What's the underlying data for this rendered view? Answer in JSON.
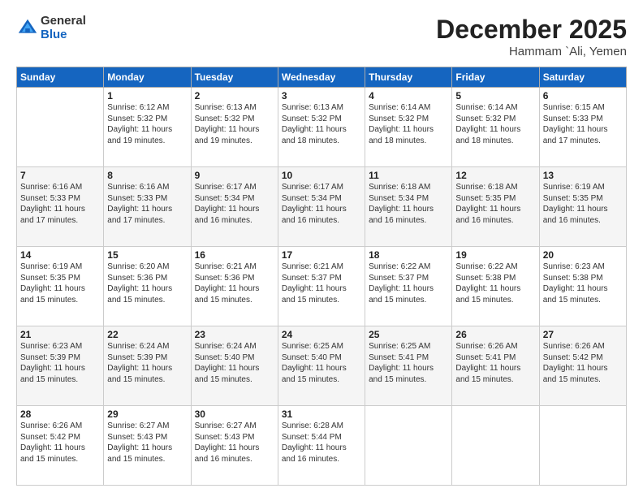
{
  "header": {
    "logo_general": "General",
    "logo_blue": "Blue",
    "month": "December 2025",
    "location": "Hammam `Ali, Yemen"
  },
  "weekdays": [
    "Sunday",
    "Monday",
    "Tuesday",
    "Wednesday",
    "Thursday",
    "Friday",
    "Saturday"
  ],
  "weeks": [
    [
      {
        "day": "",
        "info": ""
      },
      {
        "day": "1",
        "info": "Sunrise: 6:12 AM\nSunset: 5:32 PM\nDaylight: 11 hours\nand 19 minutes."
      },
      {
        "day": "2",
        "info": "Sunrise: 6:13 AM\nSunset: 5:32 PM\nDaylight: 11 hours\nand 19 minutes."
      },
      {
        "day": "3",
        "info": "Sunrise: 6:13 AM\nSunset: 5:32 PM\nDaylight: 11 hours\nand 18 minutes."
      },
      {
        "day": "4",
        "info": "Sunrise: 6:14 AM\nSunset: 5:32 PM\nDaylight: 11 hours\nand 18 minutes."
      },
      {
        "day": "5",
        "info": "Sunrise: 6:14 AM\nSunset: 5:32 PM\nDaylight: 11 hours\nand 18 minutes."
      },
      {
        "day": "6",
        "info": "Sunrise: 6:15 AM\nSunset: 5:33 PM\nDaylight: 11 hours\nand 17 minutes."
      }
    ],
    [
      {
        "day": "7",
        "info": "Sunrise: 6:16 AM\nSunset: 5:33 PM\nDaylight: 11 hours\nand 17 minutes."
      },
      {
        "day": "8",
        "info": "Sunrise: 6:16 AM\nSunset: 5:33 PM\nDaylight: 11 hours\nand 17 minutes."
      },
      {
        "day": "9",
        "info": "Sunrise: 6:17 AM\nSunset: 5:34 PM\nDaylight: 11 hours\nand 16 minutes."
      },
      {
        "day": "10",
        "info": "Sunrise: 6:17 AM\nSunset: 5:34 PM\nDaylight: 11 hours\nand 16 minutes."
      },
      {
        "day": "11",
        "info": "Sunrise: 6:18 AM\nSunset: 5:34 PM\nDaylight: 11 hours\nand 16 minutes."
      },
      {
        "day": "12",
        "info": "Sunrise: 6:18 AM\nSunset: 5:35 PM\nDaylight: 11 hours\nand 16 minutes."
      },
      {
        "day": "13",
        "info": "Sunrise: 6:19 AM\nSunset: 5:35 PM\nDaylight: 11 hours\nand 16 minutes."
      }
    ],
    [
      {
        "day": "14",
        "info": "Sunrise: 6:19 AM\nSunset: 5:35 PM\nDaylight: 11 hours\nand 15 minutes."
      },
      {
        "day": "15",
        "info": "Sunrise: 6:20 AM\nSunset: 5:36 PM\nDaylight: 11 hours\nand 15 minutes."
      },
      {
        "day": "16",
        "info": "Sunrise: 6:21 AM\nSunset: 5:36 PM\nDaylight: 11 hours\nand 15 minutes."
      },
      {
        "day": "17",
        "info": "Sunrise: 6:21 AM\nSunset: 5:37 PM\nDaylight: 11 hours\nand 15 minutes."
      },
      {
        "day": "18",
        "info": "Sunrise: 6:22 AM\nSunset: 5:37 PM\nDaylight: 11 hours\nand 15 minutes."
      },
      {
        "day": "19",
        "info": "Sunrise: 6:22 AM\nSunset: 5:38 PM\nDaylight: 11 hours\nand 15 minutes."
      },
      {
        "day": "20",
        "info": "Sunrise: 6:23 AM\nSunset: 5:38 PM\nDaylight: 11 hours\nand 15 minutes."
      }
    ],
    [
      {
        "day": "21",
        "info": "Sunrise: 6:23 AM\nSunset: 5:39 PM\nDaylight: 11 hours\nand 15 minutes."
      },
      {
        "day": "22",
        "info": "Sunrise: 6:24 AM\nSunset: 5:39 PM\nDaylight: 11 hours\nand 15 minutes."
      },
      {
        "day": "23",
        "info": "Sunrise: 6:24 AM\nSunset: 5:40 PM\nDaylight: 11 hours\nand 15 minutes."
      },
      {
        "day": "24",
        "info": "Sunrise: 6:25 AM\nSunset: 5:40 PM\nDaylight: 11 hours\nand 15 minutes."
      },
      {
        "day": "25",
        "info": "Sunrise: 6:25 AM\nSunset: 5:41 PM\nDaylight: 11 hours\nand 15 minutes."
      },
      {
        "day": "26",
        "info": "Sunrise: 6:26 AM\nSunset: 5:41 PM\nDaylight: 11 hours\nand 15 minutes."
      },
      {
        "day": "27",
        "info": "Sunrise: 6:26 AM\nSunset: 5:42 PM\nDaylight: 11 hours\nand 15 minutes."
      }
    ],
    [
      {
        "day": "28",
        "info": "Sunrise: 6:26 AM\nSunset: 5:42 PM\nDaylight: 11 hours\nand 15 minutes."
      },
      {
        "day": "29",
        "info": "Sunrise: 6:27 AM\nSunset: 5:43 PM\nDaylight: 11 hours\nand 15 minutes."
      },
      {
        "day": "30",
        "info": "Sunrise: 6:27 AM\nSunset: 5:43 PM\nDaylight: 11 hours\nand 16 minutes."
      },
      {
        "day": "31",
        "info": "Sunrise: 6:28 AM\nSunset: 5:44 PM\nDaylight: 11 hours\nand 16 minutes."
      },
      {
        "day": "",
        "info": ""
      },
      {
        "day": "",
        "info": ""
      },
      {
        "day": "",
        "info": ""
      }
    ]
  ]
}
